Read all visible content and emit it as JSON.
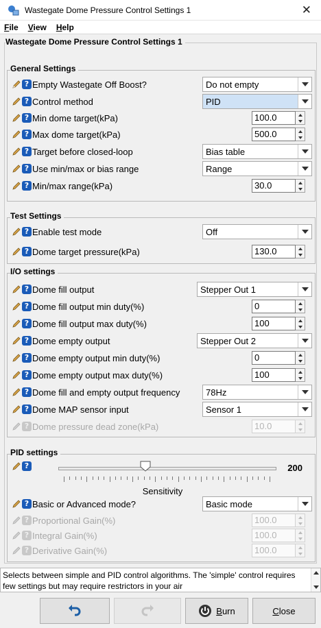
{
  "window": {
    "title": "Wastegate Dome Pressure Control Settings 1",
    "close_glyph": "✕"
  },
  "menu": [
    {
      "key": "F",
      "rest": "ile"
    },
    {
      "key": "V",
      "rest": "iew"
    },
    {
      "key": "H",
      "rest": "elp"
    }
  ],
  "panel_title": "Wastegate Dome Pressure Control Settings 1",
  "general": {
    "title": "General Settings",
    "rows": [
      {
        "label": "Empty Wastegate Off Boost?",
        "value": "Do not empty"
      },
      {
        "label": "Control method",
        "value": "PID"
      },
      {
        "label": "Min dome target(kPa)",
        "value": "100.0"
      },
      {
        "label": "Max dome target(kPa)",
        "value": "500.0"
      },
      {
        "label": "Target before closed-loop",
        "value": "Bias table"
      },
      {
        "label": "Use min/max or bias range",
        "value": "Range"
      },
      {
        "label": "Min/max range(kPa)",
        "value": "30.0"
      }
    ]
  },
  "test": {
    "title": "Test Settings",
    "rows": [
      {
        "label": "Enable test mode",
        "value": "Off"
      },
      {
        "label": "Dome target pressure(kPa)",
        "value": "130.0"
      }
    ]
  },
  "io": {
    "title": "I/O settings",
    "rows": [
      {
        "label": "Dome fill output",
        "value": "Stepper Out 1"
      },
      {
        "label": "Dome fill output min duty(%)",
        "value": "0"
      },
      {
        "label": "Dome fill output max duty(%)",
        "value": "100"
      },
      {
        "label": "Dome empty output",
        "value": "Stepper Out 2"
      },
      {
        "label": "Dome empty output min duty(%)",
        "value": "0"
      },
      {
        "label": "Dome empty output max duty(%)",
        "value": "100"
      },
      {
        "label": "Dome fill and empty output frequency",
        "value": "78Hz"
      },
      {
        "label": "Dome MAP sensor input",
        "value": "Sensor 1"
      },
      {
        "label": "Dome pressure dead zone(kPa)",
        "value": "10.0"
      }
    ]
  },
  "pid": {
    "title": "PID settings",
    "slider_value": "200",
    "slider_fraction": 0.4,
    "slider_caption": "Sensitivity",
    "rows": [
      {
        "label": "Basic or Advanced mode?",
        "value": "Basic mode"
      },
      {
        "label": "Proportional Gain(%)",
        "value": "100.0"
      },
      {
        "label": "Integral Gain(%)",
        "value": "100.0"
      },
      {
        "label": "Derivative Gain(%)",
        "value": "100.0"
      }
    ]
  },
  "description": "Selects between simple and PID control algorithms. The 'simple' control requires few settings but may require restrictors in your air",
  "buttons": {
    "burn_key": "B",
    "burn_rest": "urn",
    "close_key": "C",
    "close_rest": "lose"
  },
  "colors": {
    "accent": "#1a5bb8",
    "selected_combo": "#cfe2f6"
  }
}
